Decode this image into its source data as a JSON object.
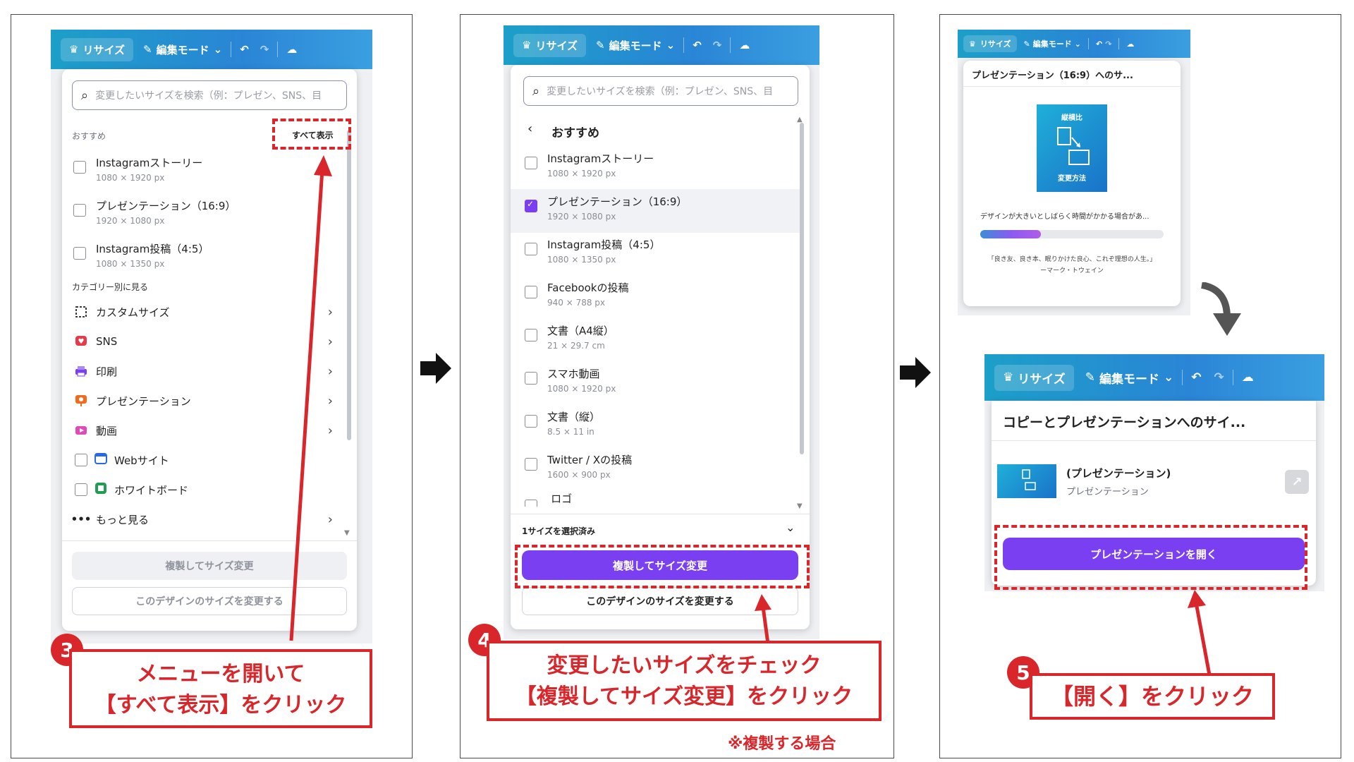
{
  "toolbar": {
    "resize_label": "リサイズ",
    "edit_mode_label": "編集モード"
  },
  "step3": {
    "search_placeholder": "変更したいサイズを検索（例：プレゼン、SNS、目",
    "recommended_label": "おすすめ",
    "show_all_label": "すべて表示",
    "items": [
      {
        "name": "Instagramストーリー",
        "size": "1080 × 1920 px"
      },
      {
        "name": "プレゼンテーション（16:9）",
        "size": "1920 × 1080 px"
      },
      {
        "name": "Instagram投稿（4:5）",
        "size": "1080 × 1350 px"
      }
    ],
    "category_header": "カテゴリー別に見る",
    "categories": [
      {
        "label": "カスタムサイズ",
        "icon": "custom-size-icon"
      },
      {
        "label": "SNS",
        "icon": "sns-heart-icon"
      },
      {
        "label": "印刷",
        "icon": "print-icon"
      },
      {
        "label": "プレゼンテーション",
        "icon": "presentation-icon"
      },
      {
        "label": "動画",
        "icon": "video-icon"
      },
      {
        "label": "Webサイト",
        "icon": "website-icon"
      },
      {
        "label": "ホワイトボード",
        "icon": "whiteboard-icon"
      },
      {
        "label": "もっと見る",
        "icon": "more-dots-icon"
      }
    ],
    "copy_resize_label": "複製してサイズ変更",
    "resize_this_label": "このデザインのサイズを変更する",
    "badge": "3",
    "callout_line1": "メニューを開いて",
    "callout_line2": "【すべて表示】をクリック"
  },
  "step4": {
    "search_placeholder": "変更したいサイズを検索（例：プレゼン、SNS、目",
    "back_title": "おすすめ",
    "items": [
      {
        "name": "Instagramストーリー",
        "size": "1080 × 1920 px",
        "checked": false
      },
      {
        "name": "プレゼンテーション（16:9）",
        "size": "1920 × 1080 px",
        "checked": true
      },
      {
        "name": "Instagram投稿（4:5）",
        "size": "1080 × 1350 px",
        "checked": false
      },
      {
        "name": "Facebookの投稿",
        "size": "940 × 788 px",
        "checked": false
      },
      {
        "name": "文書（A4縦）",
        "size": "21 × 29.7 cm",
        "checked": false
      },
      {
        "name": "スマホ動画",
        "size": "1080 × 1920 px",
        "checked": false
      },
      {
        "name": "文書（縦）",
        "size": "8.5 × 11 in",
        "checked": false
      },
      {
        "name": "Twitter / Xの投稿",
        "size": "1600 × 900 px",
        "checked": false
      },
      {
        "name": "ロゴ",
        "size": "",
        "checked": false
      }
    ],
    "selected_count": "1サイズを選択済み",
    "copy_resize_label": "複製してサイズ変更",
    "resize_this_label": "このデザインのサイズを変更する",
    "badge": "4",
    "callout_line1": "変更したいサイズをチェック",
    "callout_line2": "【複製してサイズ変更】をクリック",
    "note": "※複製する場合"
  },
  "step5": {
    "progress_title": "プレゼンテーション（16:9）へのサ...",
    "thumb_top": "縦横比",
    "thumb_bottom": "変更方法",
    "wait_text": "デザインが大きいとしばらく時間がかかる場合があ...",
    "progress": 0.33,
    "quote_line1": "「良き友、良き本、眠りかけた良心、これぞ理想の人生。」",
    "quote_line2": "ーマーク・トウェイン",
    "done_title": "コピーとプレゼンテーションへのサイ...",
    "result_name": "(プレゼンテーション)",
    "result_type": "プレゼンテーション",
    "open_label": "プレゼンテーションを開く",
    "badge": "5",
    "callout": "【開く】をクリック"
  },
  "colors": {
    "accent": "#7b3ff2",
    "callout_red": "#d9262b",
    "toolbar_blue": "#1c9fc8"
  }
}
